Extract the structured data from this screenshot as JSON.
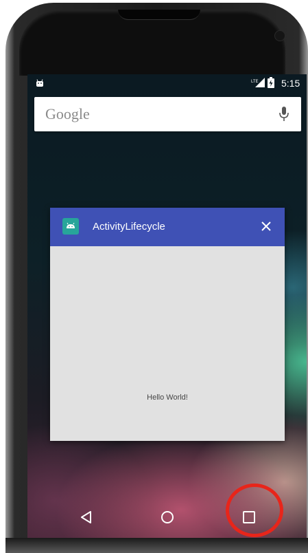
{
  "status_bar": {
    "time": "5:15",
    "notification_icon": "android-robot-icon",
    "signal_label": "LTE"
  },
  "search": {
    "logo_text": "Google",
    "mic_icon": "microphone-icon"
  },
  "recent_app": {
    "title": "ActivityLifecycle",
    "body_text": "Hello World!",
    "header_color": "#3f51b5",
    "icon_color": "#27a59a"
  },
  "nav": {
    "back_icon": "back-triangle-icon",
    "home_icon": "home-circle-icon",
    "recents_icon": "recents-square-icon"
  },
  "annotation": {
    "highlight_color": "#e8251a"
  }
}
